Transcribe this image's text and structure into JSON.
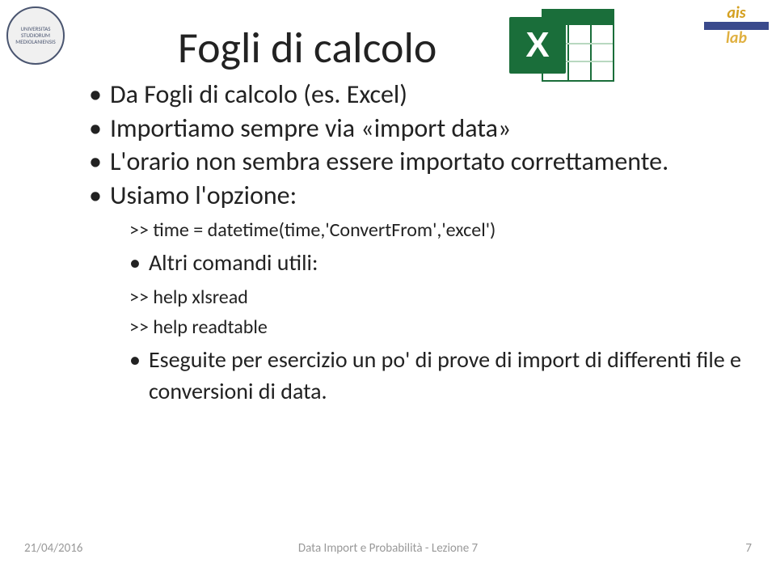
{
  "title": "Fogli di calcolo",
  "bullets": {
    "b1": "Da Fogli di calcolo (es. Excel)",
    "b2": "Importiamo sempre via «import data»",
    "b3": "L'orario non sembra essere importato correttamente.",
    "b4": "Usiamo l'opzione:",
    "code1": ">> time = datetime(time,'ConvertFrom','excel')",
    "b5": "Altri comandi utili:",
    "code2": ">> help xlsread",
    "code3": ">> help readtable",
    "b6": "Eseguite per esercizio un po' di prove di import di differenti file e conversioni di data."
  },
  "footer": {
    "date": "21/04/2016",
    "center": "Data Import e Probabilità - Lezione 7",
    "page": "7"
  },
  "icons": {
    "excel": "excel-icon",
    "seal": "university-seal",
    "aislab": "aislab-logo"
  },
  "excel_letter": "X",
  "logo_left_text": "UNIVERSITAS STUDIORUM MEDIOLANIENSIS",
  "logo_right_top": "ais",
  "logo_right_bottom": "lab"
}
